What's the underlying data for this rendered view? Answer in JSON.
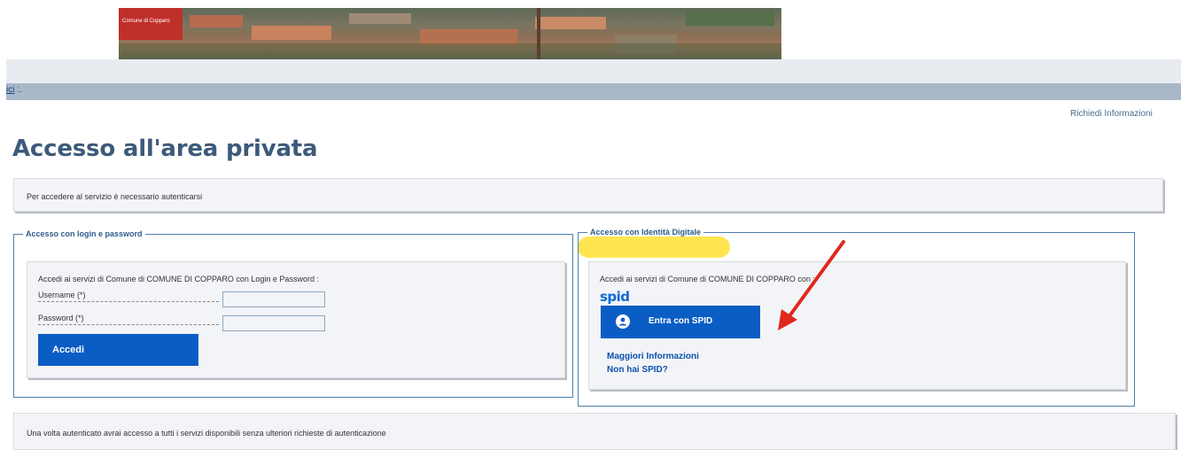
{
  "banner": {
    "logo_text": "Comune di Copparo"
  },
  "breadcrumb": {
    "link": "ici",
    "sep": ":."
  },
  "header": {
    "info_link": "Richiedi Informazioni"
  },
  "page": {
    "title": "Accesso all'area privata"
  },
  "notices": {
    "top": "Per accedere al servizio è necessario autenticarsi",
    "bottom": "Una volta autenticato avrai accesso a tutti i servizi disponibili senza ulteriori richieste di autenticazione"
  },
  "login": {
    "legend": "Accesso con login e password",
    "intro": "Accedi ai servizi di Comune di COMUNE DI COPPARO con Login e Password :",
    "username_label": "Username (*)",
    "password_label": "Password (*)",
    "username_value": "",
    "password_value": "",
    "submit_label": "Accedi"
  },
  "spid": {
    "legend": "Accesso con Identità Digitale",
    "intro": "Accedi ai servizi di Comune di COMUNE DI COPPARO con :",
    "logo": "spid",
    "button_label": "Entra con SPID",
    "more_info": "Maggiori Informazioni",
    "no_spid": "Non hai SPID?"
  },
  "colors": {
    "title": "#3c5a7a",
    "button_blue": "#0a5dc4",
    "highlight": "#ffe650",
    "arrow": "#e0281e",
    "fieldset_border": "#4f7ea8"
  }
}
